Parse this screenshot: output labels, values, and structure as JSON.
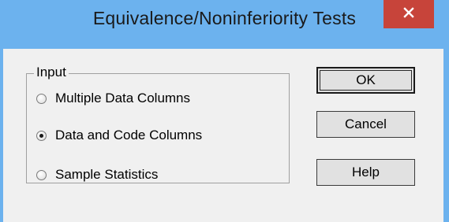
{
  "window": {
    "title": "Equivalence/Noninferiority Tests",
    "close_icon": "close-icon"
  },
  "input_group": {
    "label": "Input",
    "options": [
      {
        "label": "Multiple Data Columns",
        "selected": false
      },
      {
        "label": "Data and Code Columns",
        "selected": true
      },
      {
        "label": "Sample Statistics",
        "selected": false
      }
    ]
  },
  "buttons": {
    "ok_label": "OK",
    "cancel_label": "Cancel",
    "help_label": "Help"
  },
  "colors": {
    "titlebar": "#6cb2ee",
    "close_button": "#c7443a",
    "client_background": "#f0f0f0"
  }
}
